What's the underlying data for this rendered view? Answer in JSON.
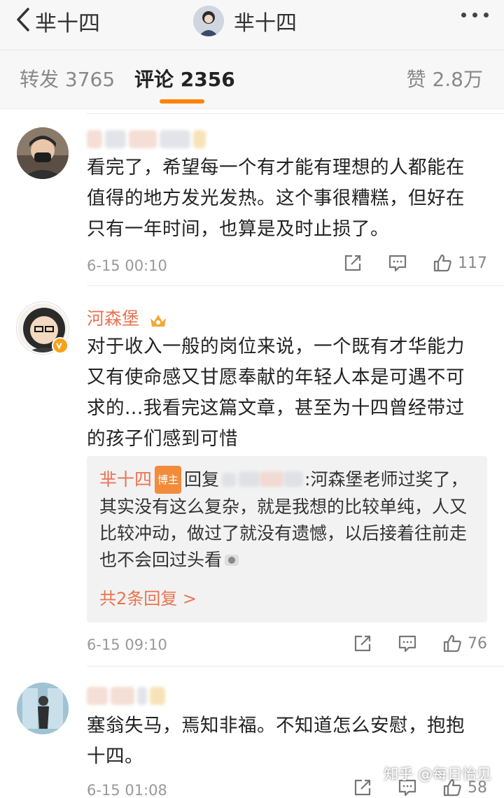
{
  "header": {
    "back_label": "芈十四",
    "title": "芈十四"
  },
  "tabs": {
    "repost": "转发 3765",
    "comment": "评论 2356",
    "like": "赞 2.8万"
  },
  "comments": [
    {
      "text": "看完了，希望每一个有才能有理想的人都能在值得的地方发光发热。这个事很糟糕，但好在只有一年时间，也算是及时止损了。",
      "time": "6-15 00:10",
      "likes": "117"
    },
    {
      "name": "河森堡",
      "text": "对于收入一般的岗位来说，一个既有才华能力又有使命感又甘愿奉献的年轻人本是可遇不可求的...我看完这篇文章，甚至为十四曾经带过的孩子们感到可惜",
      "reply": {
        "author": "芈十四",
        "badge": "博主",
        "prefix": "回复",
        "body": ":河森堡老师过奖了，其实没有这么复杂，就是我想的比较单纯，人又比较冲动，做过了就没有遗憾，以后接着往前走也不会回过头看",
        "more": "共2条回复 >"
      },
      "time": "6-15 09:10",
      "likes": "76"
    },
    {
      "text": "塞翁失马，焉知非福。不知道怎么安慰，抱抱十四。",
      "time": "6-15 01:08",
      "likes": "58"
    }
  ],
  "watermark": "知乎 @每日怡见",
  "colors": {
    "accent": "#ff8200",
    "link": "#eb7350"
  }
}
